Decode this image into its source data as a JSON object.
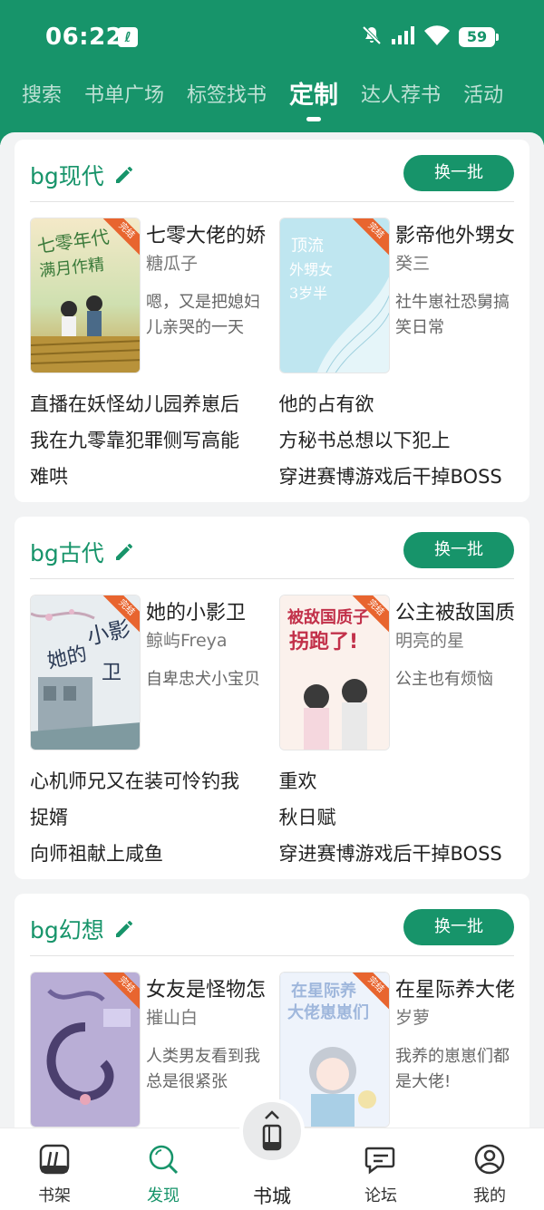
{
  "status": {
    "time": "06:22",
    "app_icon": "ℓ",
    "battery": "59"
  },
  "tabs": [
    {
      "label": "搜索"
    },
    {
      "label": "书单广场"
    },
    {
      "label": "标签找书"
    },
    {
      "label": "定制"
    },
    {
      "label": "达人荐书"
    },
    {
      "label": "活动"
    }
  ],
  "active_tab": "定制",
  "sections": [
    {
      "title": "bg现代",
      "refresh_label": "换一批",
      "books": [
        {
          "name": "七零大佬的娇妻",
          "author": "糖瓜子",
          "desc": "嗯，又是把媳妇儿亲哭的一天",
          "badge": "完结"
        },
        {
          "name": "影帝他外甥女",
          "author": "癸三",
          "desc": "社牛崽社恐舅搞笑日常",
          "badge": "完结"
        }
      ],
      "rows": [
        [
          "直播在妖怪幼儿园养崽后",
          "他的占有欲"
        ],
        [
          "我在九零靠犯罪侧写高能",
          "方秘书总想以下犯上"
        ],
        [
          "难哄",
          "穿进赛博游戏后干掉BOSS"
        ]
      ]
    },
    {
      "title": "bg古代",
      "refresh_label": "换一批",
      "books": [
        {
          "name": "她的小影卫",
          "author": "鲸屿Freya",
          "desc": "自卑忠犬小宝贝",
          "badge": "完结"
        },
        {
          "name": "公主被敌国质子拐跑了",
          "author": "明亮的星",
          "desc": "公主也有烦恼",
          "badge": "完结"
        }
      ],
      "rows": [
        [
          "心机师兄又在装可怜钓我",
          "重欢"
        ],
        [
          "捉婿",
          "秋日赋"
        ],
        [
          "向师祖献上咸鱼",
          "穿进赛博游戏后干掉BOSS"
        ]
      ]
    },
    {
      "title": "bg幻想",
      "refresh_label": "换一批",
      "books": [
        {
          "name": "女友是怪物怎么办",
          "author": "摧山白",
          "desc": "人类男友看到我总是很紧张",
          "badge": "完结"
        },
        {
          "name": "在星际养大佬崽崽们",
          "author": "岁萝",
          "desc": "我养的崽崽们都是大佬!",
          "badge": "完结"
        }
      ]
    }
  ],
  "nav": [
    {
      "label": "书架",
      "icon": "bookshelf-icon"
    },
    {
      "label": "发现",
      "icon": "discover-icon"
    },
    {
      "label": "书城",
      "icon": "bookstore-icon"
    },
    {
      "label": "论坛",
      "icon": "forum-icon"
    },
    {
      "label": "我的",
      "icon": "profile-icon"
    }
  ],
  "colors": {
    "brand": "#17946a",
    "badge": "#e8652f"
  }
}
